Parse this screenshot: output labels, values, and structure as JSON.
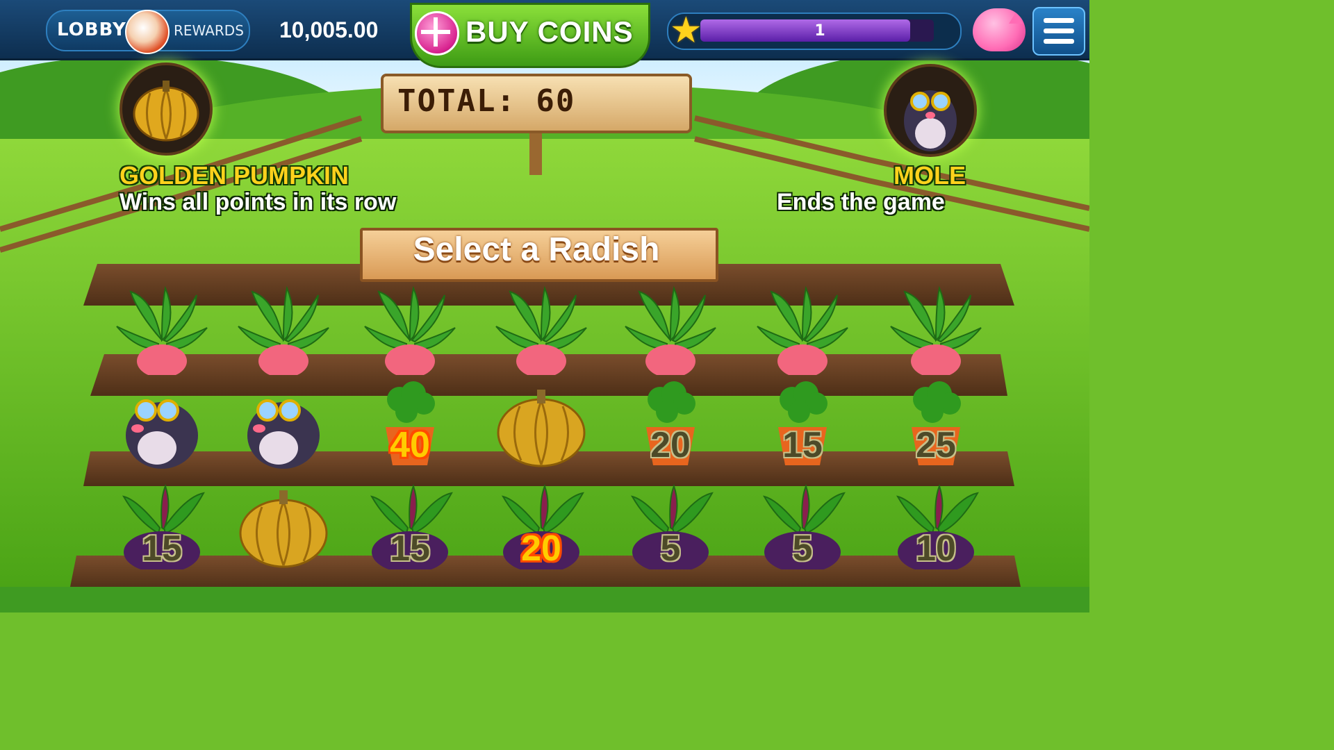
{
  "topbar": {
    "lobby_label": "LOBBY",
    "rewards_label": "REWARDS",
    "coin_balance": "10,005.00",
    "buy_coins_label": "BUY COINS",
    "level": "1",
    "xp_progress": 0.9
  },
  "sign": {
    "total_label": "TOTAL: 60"
  },
  "legend": {
    "golden_pumpkin_title": "GOLDEN PUMPKIN",
    "golden_pumpkin_desc": "Wins all points in its row",
    "mole_title": "MOLE",
    "mole_desc": "Ends the game"
  },
  "prompt": "Select a Radish",
  "board": {
    "row1": [
      {
        "type": "radish"
      },
      {
        "type": "radish"
      },
      {
        "type": "radish"
      },
      {
        "type": "radish"
      },
      {
        "type": "radish"
      },
      {
        "type": "radish"
      },
      {
        "type": "radish"
      }
    ],
    "row2": [
      {
        "type": "mole",
        "value": ""
      },
      {
        "type": "mole",
        "value": ""
      },
      {
        "type": "carrot",
        "value": "40",
        "highlight": true
      },
      {
        "type": "golden-pumpkin",
        "value": ""
      },
      {
        "type": "carrot",
        "value": "20",
        "highlight": false
      },
      {
        "type": "carrot",
        "value": "15",
        "highlight": false
      },
      {
        "type": "carrot",
        "value": "25",
        "highlight": false
      }
    ],
    "row3": [
      {
        "type": "beet",
        "value": "15",
        "highlight": false
      },
      {
        "type": "golden-pumpkin",
        "value": ""
      },
      {
        "type": "beet",
        "value": "15",
        "highlight": false
      },
      {
        "type": "beet",
        "value": "20",
        "highlight": true
      },
      {
        "type": "beet",
        "value": "5",
        "highlight": false
      },
      {
        "type": "beet",
        "value": "5",
        "highlight": false
      },
      {
        "type": "beet",
        "value": "10",
        "highlight": false
      }
    ]
  },
  "colors": {
    "grass": "#6fbf2c",
    "soil": "#6b4226",
    "radish": "#f2667e",
    "beet": "#4a1f5e",
    "carrot": "#e8651e",
    "pumpkin": "#d9a521",
    "mole": "#3b3450"
  }
}
